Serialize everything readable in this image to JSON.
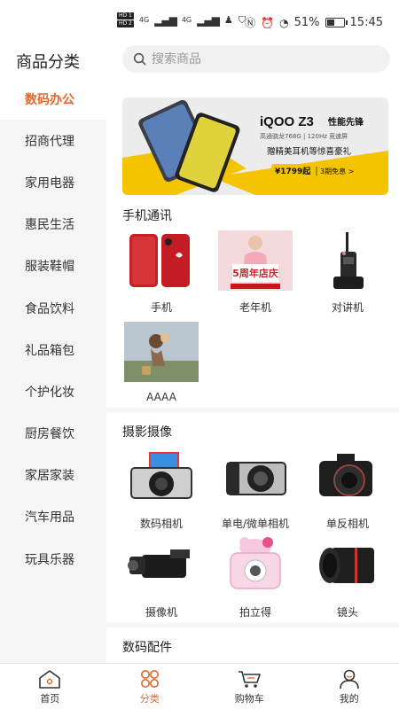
{
  "status_bar": {
    "hd1": "HD 1",
    "hd2": "HD 2",
    "net1": "4G",
    "net2": "4G",
    "battery_text": "51%",
    "battery_level": 0.51,
    "time": "15:45"
  },
  "header": {
    "title": "商品分类",
    "search_placeholder": "搜索商品"
  },
  "sidebar": {
    "items": [
      {
        "label": "数码办公"
      },
      {
        "label": "招商代理"
      },
      {
        "label": "家用电器"
      },
      {
        "label": "惠民生活"
      },
      {
        "label": "服装鞋帽"
      },
      {
        "label": "食品饮料"
      },
      {
        "label": "礼品箱包"
      },
      {
        "label": "个护化妆"
      },
      {
        "label": "厨房餐饮"
      },
      {
        "label": "家居家装"
      },
      {
        "label": "汽车用品"
      },
      {
        "label": "玩具乐器"
      }
    ]
  },
  "banner": {
    "brand": "iQOO Z3",
    "tagline": "性能先锋",
    "spec": "高通骁龙768G | 120Hz 竞速屏",
    "gift": "赠精美耳机等惊喜豪礼",
    "price": "¥1799起",
    "installment": "3期免息 >"
  },
  "sections": [
    {
      "title": "手机通讯",
      "items": [
        {
          "label": "手机",
          "icon": "red-phones-image"
        },
        {
          "label": "老年机",
          "icon": "anniversary-promo-image"
        },
        {
          "label": "对讲机",
          "icon": "walkie-talkie-image"
        },
        {
          "label": "AAAA",
          "icon": "cartoon-image"
        }
      ]
    },
    {
      "title": "摄影摄像",
      "items": [
        {
          "label": "数码相机",
          "icon": "digital-camera-image"
        },
        {
          "label": "单电/微单相机",
          "icon": "mirrorless-camera-image"
        },
        {
          "label": "单反相机",
          "icon": "dslr-camera-image"
        },
        {
          "label": "摄像机",
          "icon": "camcorder-image"
        },
        {
          "label": "拍立得",
          "icon": "instant-camera-image"
        },
        {
          "label": "镜头",
          "icon": "lens-image"
        }
      ]
    },
    {
      "title": "数码配件"
    }
  ],
  "promo_badge": {
    "line1": "5周年",
    "line2": "店庆"
  },
  "tabs": [
    {
      "label": "首页",
      "icon": "home-icon"
    },
    {
      "label": "分类",
      "icon": "category-icon"
    },
    {
      "label": "购物车",
      "icon": "cart-icon"
    },
    {
      "label": "我的",
      "icon": "profile-icon"
    }
  ],
  "colors": {
    "accent": "#e5682a",
    "banner_yellow": "#f5c400"
  }
}
